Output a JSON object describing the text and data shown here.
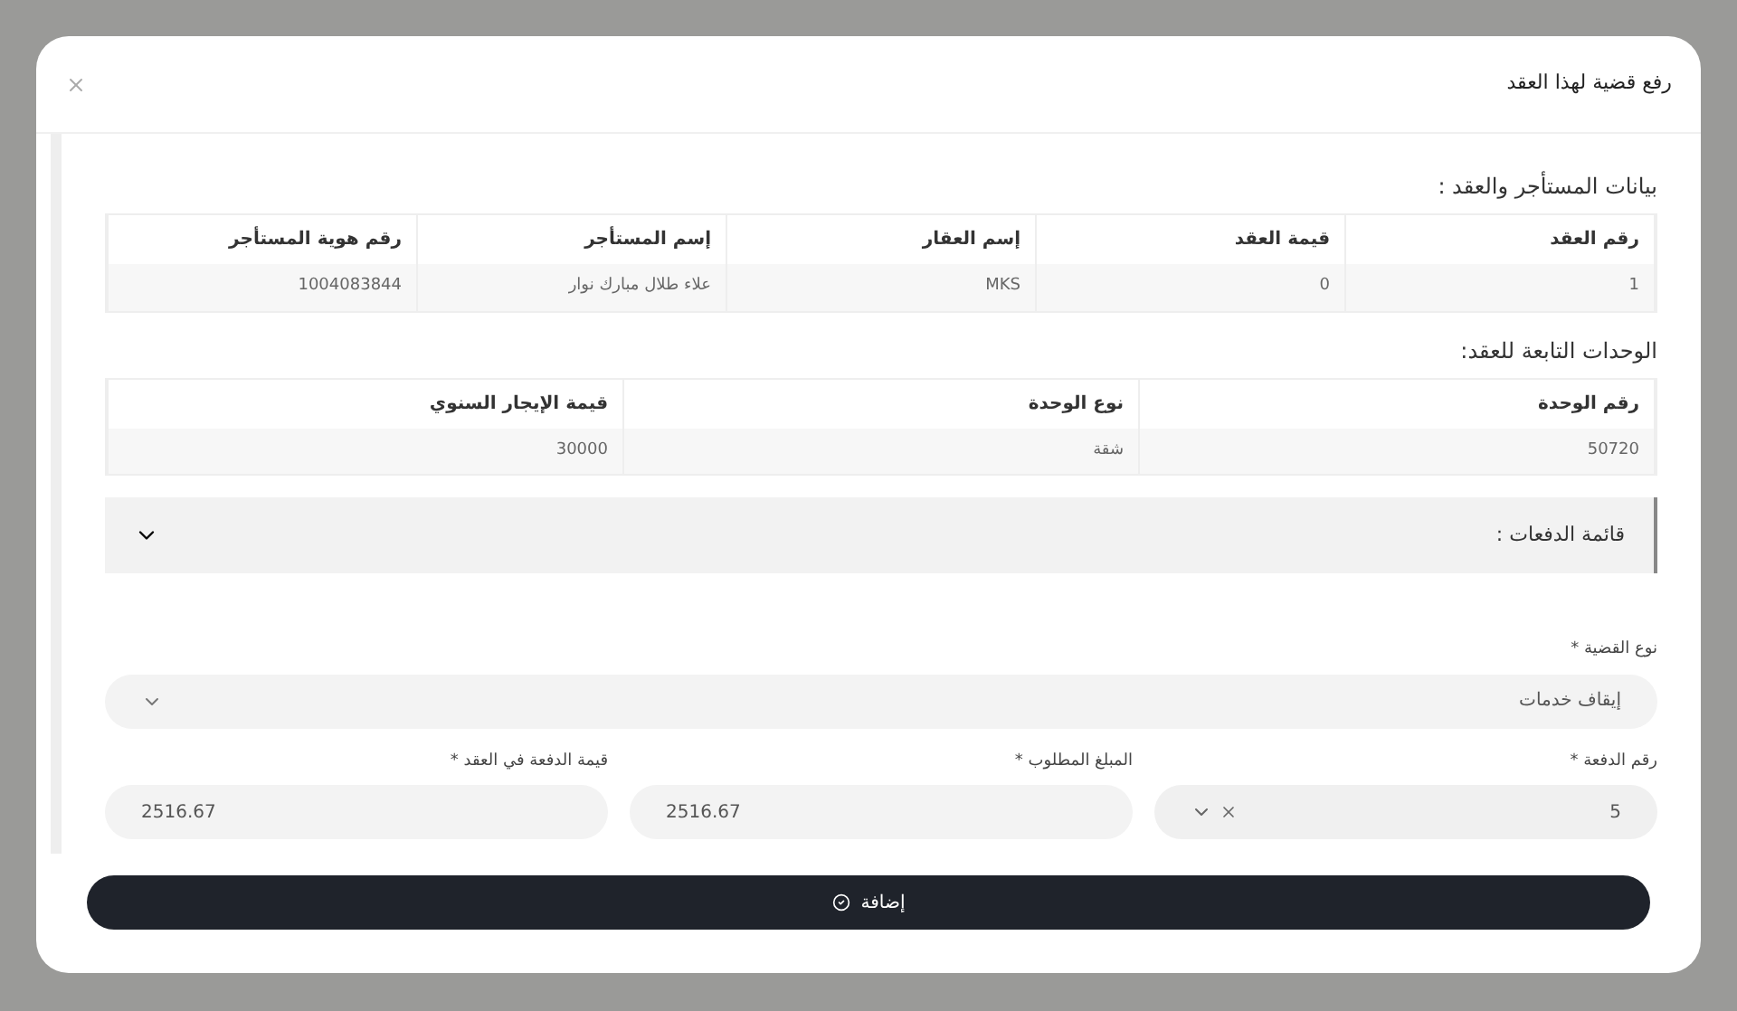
{
  "dialog": {
    "title": "رفع قضية لهذا العقد"
  },
  "contract_section": {
    "heading": "بيانات المستأجر والعقد :",
    "columns": [
      "رقم العقد",
      "قيمة العقد",
      "إسم العقار",
      "إسم المستأجر",
      "رقم هوية المستأجر"
    ],
    "rows": [
      [
        "1",
        "0",
        "MKS",
        "علاء طلال مبارك نوار",
        "1004083844"
      ]
    ]
  },
  "units_section": {
    "heading": "الوحدات التابعة للعقد:",
    "columns": [
      "رقم الوحدة",
      "نوع الوحدة",
      "قيمة الإيجار السنوي"
    ],
    "rows": [
      [
        "50720",
        "شقة",
        "30000"
      ]
    ]
  },
  "payments_accordion": {
    "label": "قائمة الدفعات :",
    "expanded": false
  },
  "case_type": {
    "label": "نوع القضية *",
    "value": "إيقاف خدمات"
  },
  "fields": [
    {
      "kind": "select",
      "label": "رقم الدفعة *",
      "value": "5"
    },
    {
      "kind": "input",
      "label": "المبلغ المطلوب *",
      "value": "2516.67"
    },
    {
      "kind": "input",
      "label": "قيمة الدفعة في العقد *",
      "value": "2516.67"
    }
  ],
  "submit": {
    "label": "إضافة"
  }
}
